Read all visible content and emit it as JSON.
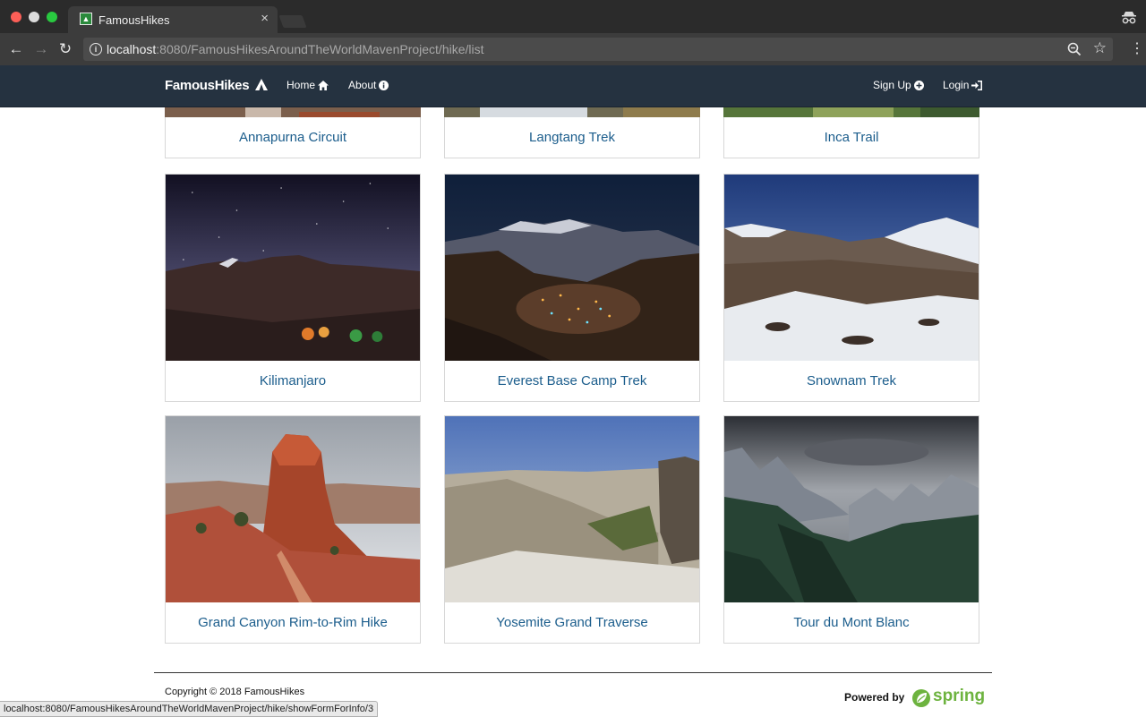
{
  "browser": {
    "tab_title": "FamousHikes",
    "tab_close": "×",
    "url_host": "localhost",
    "url_rest": ":8080/FamousHikesAroundTheWorldMavenProject/hike/list",
    "status_url": "localhost:8080/FamousHikesAroundTheWorldMavenProject/hike/showFormForInfo/3"
  },
  "navbar": {
    "brand": "FamousHikes",
    "home": "Home",
    "about": "About",
    "signup": "Sign Up",
    "login": "Login"
  },
  "hikes_partial": [
    "Annapurna Circuit",
    "Langtang Trek",
    "Inca Trail"
  ],
  "hikes": [
    "Kilimanjaro",
    "Everest Base Camp Trek",
    "Snownam Trek",
    "Grand Canyon Rim-to-Rim Hike",
    "Yosemite Grand Traverse",
    "Tour du Mont Blanc"
  ],
  "footer": {
    "copyright": "Copyright © 2018 FamousHikes",
    "powered_by": "Powered by",
    "spring": "spring"
  },
  "colors": {
    "navbar_bg": "#253240",
    "link": "#1b5d8c",
    "spring_green": "#6db33f"
  }
}
